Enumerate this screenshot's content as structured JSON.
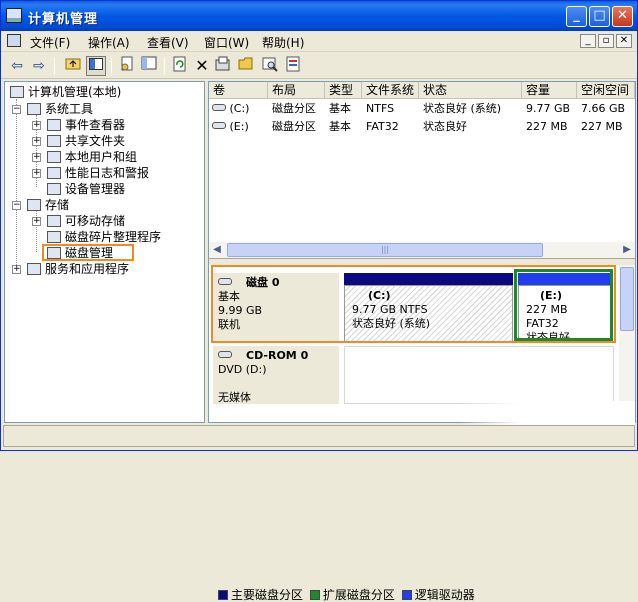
{
  "window": {
    "title": "计算机管理"
  },
  "titlebar": {
    "min": "_",
    "max": "□",
    "close": "✕"
  },
  "menu": {
    "items": [
      "文件(F)",
      "操作(A)",
      "查看(V)",
      "窗口(W)",
      "帮助(H)"
    ],
    "mdi": [
      "_",
      "▫",
      "✕"
    ]
  },
  "toolbar": {
    "back": "⇦",
    "forward": "⇨"
  },
  "tree": {
    "root": "计算机管理(本地)",
    "system_tools": "系统工具",
    "event_viewer": "事件查看器",
    "shared_folders": "共享文件夹",
    "local_users": "本地用户和组",
    "perf_logs": "性能日志和警报",
    "device_manager": "设备管理器",
    "storage": "存储",
    "removable": "可移动存储",
    "defrag": "磁盘碎片整理程序",
    "disk_mgmt": "磁盘管理",
    "services": "服务和应用程序"
  },
  "volumes": {
    "headers": [
      "卷",
      "布局",
      "类型",
      "文件系统",
      "状态",
      "容量",
      "空闲空间"
    ],
    "rows": [
      [
        "(C:)",
        "磁盘分区",
        "基本",
        "NTFS",
        "状态良好 (系统)",
        "9.77 GB",
        "7.66 GB"
      ],
      [
        "(E:)",
        "磁盘分区",
        "基本",
        "FAT32",
        "状态良好",
        "227 MB",
        "227 MB"
      ]
    ]
  },
  "scroll": {
    "left": "◀",
    "right": "▶",
    "grip": "|||"
  },
  "disk0": {
    "name": "磁盘 0",
    "type": "基本",
    "size": "9.99 GB",
    "status": "联机"
  },
  "part_c": {
    "name": "(C:)",
    "detail": "9.77 GB NTFS",
    "status": "状态良好 (系统)"
  },
  "part_e": {
    "name": "(E:)",
    "detail": "227 MB FAT32",
    "status": "状态良好"
  },
  "cdrom": {
    "name": "CD-ROM 0",
    "drive": "DVD (D:)",
    "status": "无媒体"
  },
  "legend": [
    "主要磁盘分区",
    "扩展磁盘分区",
    "逻辑驱动器"
  ],
  "colors": {
    "primary": "#0a0a80",
    "extended": "#1b8a2b",
    "logical": "#1f3ef0",
    "highlight": "#f08a24"
  }
}
